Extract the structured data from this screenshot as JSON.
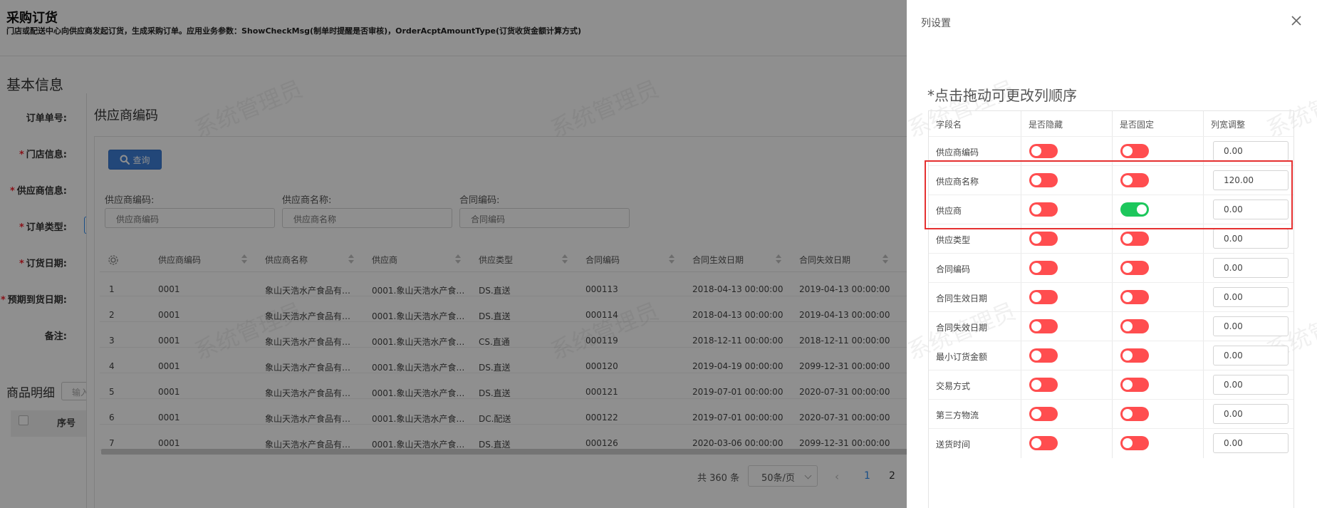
{
  "page": {
    "title": "采购订货",
    "description": "门店或配送中心向供应商发起订货，生成采购订单。应用业务参数：ShowCheckMsg(制单时提醒是否审核)，OrderAcptAmountType(订货收货金额计算方式)"
  },
  "basic_info": {
    "title": "基本信息",
    "fields": [
      {
        "label": "订单单号:",
        "required": false
      },
      {
        "label": "门店信息:",
        "required": true
      },
      {
        "label": "供应商信息:",
        "required": true
      },
      {
        "label": "订单类型:",
        "required": true
      },
      {
        "label": "订货日期:",
        "required": true
      },
      {
        "label": "预期到货日期:",
        "required": true
      },
      {
        "label": "备注:",
        "required": false
      }
    ]
  },
  "goods_detail": {
    "title": "商品明细",
    "input_placeholder": "输入",
    "seq_header": "序号"
  },
  "vendor_dialog": {
    "title": "供应商编码",
    "query_button": "查询",
    "filters": [
      {
        "label": "供应商编码:",
        "placeholder": "供应商编码"
      },
      {
        "label": "供应商名称:",
        "placeholder": "供应商名称"
      },
      {
        "label": "合同编码:",
        "placeholder": "合同编码"
      }
    ],
    "columns": [
      "供应商编码",
      "供应商名称",
      "供应商",
      "供应类型",
      "合同编码",
      "合同生效日期",
      "合同失效日期"
    ],
    "rows": [
      {
        "no": "1",
        "code": "0001",
        "name": "象山天浩水产食品有…",
        "vendor": "0001.象山天浩水产食…",
        "type": "DS.直送",
        "contract": "000113",
        "start": "2018-04-13 00:00:00",
        "end": "2019-04-13 00:00:00"
      },
      {
        "no": "2",
        "code": "0001",
        "name": "象山天浩水产食品有…",
        "vendor": "0001.象山天浩水产食…",
        "type": "DS.直送",
        "contract": "000114",
        "start": "2018-04-13 00:00:00",
        "end": "2019-04-13 00:00:00"
      },
      {
        "no": "3",
        "code": "0001",
        "name": "象山天浩水产食品有…",
        "vendor": "0001.象山天浩水产食…",
        "type": "CS.直通",
        "contract": "000119",
        "start": "2018-12-11 00:00:00",
        "end": "2018-12-11 00:00:00"
      },
      {
        "no": "4",
        "code": "0001",
        "name": "象山天浩水产食品有…",
        "vendor": "0001.象山天浩水产食…",
        "type": "DS.直送",
        "contract": "000120",
        "start": "2019-04-19 00:00:00",
        "end": "2099-12-31 00:00:00"
      },
      {
        "no": "5",
        "code": "0001",
        "name": "象山天浩水产食品有…",
        "vendor": "0001.象山天浩水产食…",
        "type": "DS.直送",
        "contract": "000121",
        "start": "2019-07-01 00:00:00",
        "end": "2020-07-31 00:00:00"
      },
      {
        "no": "6",
        "code": "0001",
        "name": "象山天浩水产食品有…",
        "vendor": "0001.象山天浩水产食…",
        "type": "DC.配送",
        "contract": "000122",
        "start": "2019-07-01 00:00:00",
        "end": "2020-07-31 00:00:00"
      },
      {
        "no": "7",
        "code": "0001",
        "name": "象山天浩水产食品有…",
        "vendor": "0001.象山天浩水产食…",
        "type": "DS.直送",
        "contract": "000126",
        "start": "2020-03-06 00:00:00",
        "end": "2099-12-31 00:00:00"
      }
    ],
    "pager": {
      "total": "共 360 条",
      "page_size": "50条/页",
      "prev": "‹",
      "pages": [
        "1",
        "2"
      ],
      "current": "1"
    }
  },
  "watermark": "系统管理员",
  "column_settings": {
    "title": "列设置",
    "drag_hint": "*点击拖动可更改列顺序",
    "headers": [
      "字段名",
      "是否隐藏",
      "是否固定",
      "列宽调整"
    ],
    "rows": [
      {
        "field": "供应商编码",
        "hidden": false,
        "fixed": false,
        "width": "0.00"
      },
      {
        "field": "供应商名称",
        "hidden": false,
        "fixed": false,
        "width": "120.00"
      },
      {
        "field": "供应商",
        "hidden": false,
        "fixed": true,
        "width": "0.00"
      },
      {
        "field": "供应类型",
        "hidden": false,
        "fixed": false,
        "width": "0.00"
      },
      {
        "field": "合同编码",
        "hidden": false,
        "fixed": false,
        "width": "0.00"
      },
      {
        "field": "合同生效日期",
        "hidden": false,
        "fixed": false,
        "width": "0.00"
      },
      {
        "field": "合同失效日期",
        "hidden": false,
        "fixed": false,
        "width": "0.00"
      },
      {
        "field": "最小订货金额",
        "hidden": false,
        "fixed": false,
        "width": "0.00"
      },
      {
        "field": "交易方式",
        "hidden": false,
        "fixed": false,
        "width": "0.00"
      },
      {
        "field": "第三方物流",
        "hidden": false,
        "fixed": false,
        "width": "0.00"
      },
      {
        "field": "送货时间",
        "hidden": false,
        "fixed": false,
        "width": "0.00"
      }
    ]
  },
  "colors": {
    "toggle_off": "#ff4d4f",
    "toggle_on": "#1dc75c",
    "primary": "#3d7fd8",
    "highlight": "#e53030"
  }
}
